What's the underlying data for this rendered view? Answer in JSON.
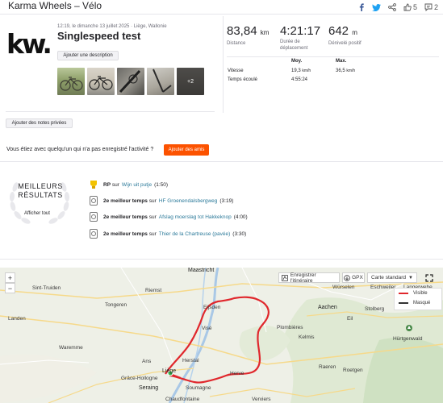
{
  "header": {
    "title": "Karma Wheels – Vélo",
    "kudos_count": "5",
    "comment_count": "2"
  },
  "activity": {
    "logo_text": "kw.",
    "meta": "12:19, le dimanche 13 juillet 2025 · Liège, Wallonie",
    "title": "Singlespeed test",
    "add_description": "Ajouter une description",
    "photos_more": "+2",
    "private_notes": "Ajouter des notes privées",
    "question": "Vous étiez avec quelqu'un qui n'a pas enregistré l'activité ?",
    "add_friends": "Ajouter des amis"
  },
  "stats": {
    "distance_value": "83,84",
    "distance_unit": "km",
    "distance_label": "Distance",
    "duration_value": "4:21:17",
    "duration_label_1": "Durée de",
    "duration_label_2": "déplacement",
    "elevation_value": "642",
    "elevation_unit": "m",
    "elevation_label": "Dénivelé positif",
    "col_avg": "Moy.",
    "col_max": "Max.",
    "speed_label": "Vitesse",
    "speed_avg": "19,3",
    "speed_max": "36,5",
    "speed_unit": "km/h",
    "elapsed_label": "Temps écoulé",
    "elapsed_value": "4:55:24"
  },
  "best": {
    "title_1": "MEILLEURS",
    "title_2": "RÉSULTATS",
    "show_all": "Afficher tout",
    "prep": "sur",
    "items": [
      {
        "rank": "RP",
        "segment": "Wijn uit putje",
        "time": "(1:50)"
      },
      {
        "rank": "2e meilleur temps",
        "segment": "HF Groenendalsbergweg",
        "time": "(3:19)"
      },
      {
        "rank": "2e meilleur temps",
        "segment": "Afslag moerslag tot Hakkeknop",
        "time": "(4:00)"
      },
      {
        "rank": "2e meilleur temps",
        "segment": "Thier de la Chartreuse (pavée)",
        "time": "(3:30)"
      }
    ]
  },
  "map": {
    "zoom_in": "+",
    "zoom_out": "−",
    "save_route": "Enregistrer l'itinéraire",
    "gpx": "GPX",
    "map_type": "Carte standard",
    "legend_visible": "Visible",
    "legend_hidden": "Masqué",
    "route_color": "#e0272c",
    "places": {
      "maastricht": "Maastricht",
      "sint_truiden": "Sint-Truiden",
      "riemst": "Riemst",
      "tongeren": "Tongeren",
      "eijsden": "Eijsden",
      "vise": "Visé",
      "landen": "Landen",
      "waremme": "Waremme",
      "ans": "Ans",
      "herstal": "Herstal",
      "liege": "Liège",
      "grace": "Grâce-Hollogne",
      "seraing": "Seraing",
      "soumagne": "Soumagne",
      "herve": "Herve",
      "verviers": "Verviers",
      "chaudfontaine": "Chaudfontaine",
      "plombieres": "Plombières",
      "kelmis": "Kelmis",
      "aachen": "Aachen",
      "wurselen": "Würselen",
      "eschweiler": "Eschweiler",
      "langerwehe": "Langerwehe",
      "stolberg": "Stolberg",
      "eilendorf": "Eil",
      "hurtgenwald": "Hürtgenwald",
      "roetgen": "Roetgen",
      "raeren": "Raeren"
    }
  }
}
